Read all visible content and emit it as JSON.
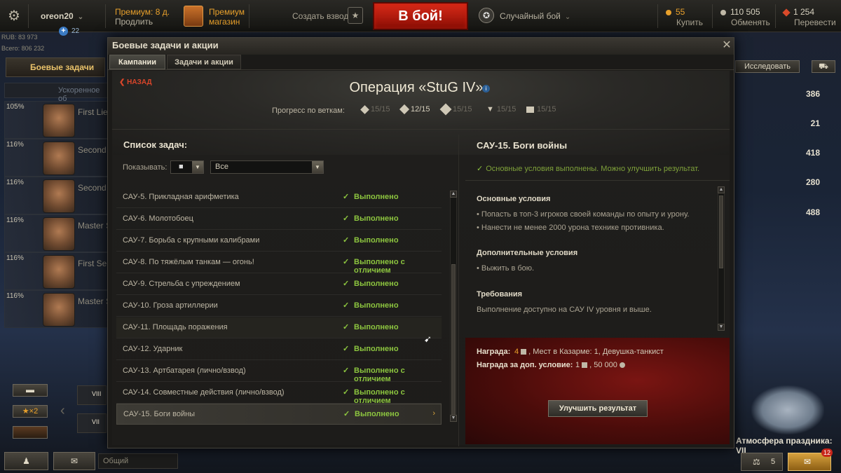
{
  "topbar": {
    "username": "oreon20",
    "plus_count": "22",
    "premium_days": "Премиум: 8 д.",
    "premium_extend": "Продлить",
    "shop_line1": "Премиум",
    "shop_line2": "магазин",
    "create_platoon": "Создать взвод",
    "battle_button": "В бой!",
    "battle_mode": "Случайный бой",
    "gold_amount": "55",
    "gold_action": "Купить",
    "credits_amount": "110 505",
    "credits_action": "Обменять",
    "xp_amount": "1 254",
    "xp_action": "Перевести",
    "rub": "RUB: 83 973",
    "total": "Всего: 806 232",
    "colors": {
      "battle": "#c41e0f",
      "gold": "#e8a02b"
    }
  },
  "garage": {
    "tasks_button": "Боевые задачи",
    "crew_top_label": "Ускоренное об",
    "crew": [
      {
        "pct": "105%",
        "rank": "First Lie"
      },
      {
        "pct": "116%",
        "rank": "Second"
      },
      {
        "pct": "116%",
        "rank": "Second"
      },
      {
        "pct": "116%",
        "rank": "Master S"
      },
      {
        "pct": "116%",
        "rank": "First Ser"
      },
      {
        "pct": "116%",
        "rank": "Master S"
      }
    ],
    "research_button": "Исследовать",
    "right_values": [
      "386",
      "21",
      "418",
      "280",
      "488"
    ],
    "x2_label": "★×2",
    "chat_placeholder": "Общий",
    "atmosphere": "Атмосфера праздника: VII",
    "bottom_count": "5",
    "notif_count": "12",
    "carousel_label1": "VIII",
    "carousel_label2": "VII"
  },
  "modal": {
    "title": "Боевые задачи и акции",
    "tabs": [
      {
        "label": "Кампании",
        "active": true
      },
      {
        "label": "Задачи и акции",
        "active": false
      }
    ],
    "back_label": "НАЗАД",
    "operation_title": "Операция «StuG IV»",
    "progress_label": "Прогресс по веткам:",
    "branches": [
      {
        "icon": "diamond-icon",
        "value": "15/15"
      },
      {
        "icon": "double-diamond-icon",
        "value": "12/15"
      },
      {
        "icon": "triple-diamond-icon",
        "value": "15/15"
      },
      {
        "icon": "triangle-icon",
        "value": "15/15"
      },
      {
        "icon": "square-icon",
        "value": "15/15"
      }
    ],
    "list_title": "Список задач:",
    "show_label": "Показывать:",
    "filter_icon_value": "■",
    "filter_value": "Все",
    "tasks": [
      {
        "name": "САУ-5. Прикладная арифметика",
        "status": "Выполнено"
      },
      {
        "name": "САУ-6. Молотобоец",
        "status": "Выполнено"
      },
      {
        "name": "САУ-7. Борьба с крупными калибрами",
        "status": "Выполнено"
      },
      {
        "name": "САУ-8. По тяжёлым танкам — огонь!",
        "status": "Выполнено с отличием"
      },
      {
        "name": "САУ-9. Стрельба с упреждением",
        "status": "Выполнено"
      },
      {
        "name": "САУ-10. Гроза артиллерии",
        "status": "Выполнено"
      },
      {
        "name": "САУ-11. Площадь поражения",
        "status": "Выполнено"
      },
      {
        "name": "САУ-12. Ударник",
        "status": "Выполнено"
      },
      {
        "name": "САУ-13. Артбатарея (лично/взвод)",
        "status": "Выполнено с отличием"
      },
      {
        "name": "САУ-14. Совместные действия (лично/взвод)",
        "status": "Выполнено с отличием"
      },
      {
        "name": "САУ-15. Боги войны",
        "status": "Выполнено"
      }
    ],
    "detail": {
      "title": "САУ-15. Боги войны",
      "status": "Основные условия выполнены. Можно улучшить результат.",
      "main_conditions_h": "Основные условия",
      "main_conditions": [
        "• Попасть в топ-3 игроков своей команды по опыту и урону.",
        "• Нанести не менее 2000 урона технике противника."
      ],
      "extra_conditions_h": "Дополнительные условия",
      "extra_conditions": [
        "• Выжить в бою."
      ],
      "requirements_h": "Требования",
      "requirements": "Выполнение доступно на САУ IV уровня и выше.",
      "reward_label": "Награда:",
      "reward_count": "4",
      "reward_rest": ", Мест в Казарме: 1, Девушка-танкист",
      "extra_reward_label": "Награда за доп. условие:",
      "extra_reward_count": "1",
      "extra_reward_rest": ", 50 000",
      "improve_button": "Улучшить результат"
    }
  }
}
